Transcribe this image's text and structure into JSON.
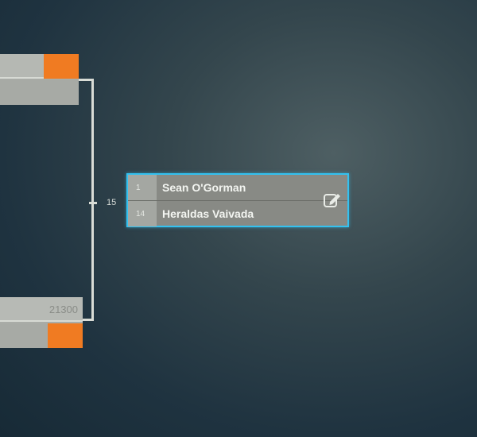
{
  "bracket": {
    "round_number": "15",
    "match": {
      "player1": {
        "seed": "1",
        "name": "Sean O'Gorman"
      },
      "player2": {
        "seed": "14",
        "name": "Heraldas Vaivada"
      }
    },
    "upper_feeder": {
      "score": ""
    },
    "lower_feeder": {
      "score": "21300"
    }
  },
  "icons": {
    "edit": "edit-icon"
  },
  "colors": {
    "highlight_border": "#33c1f0",
    "score_badge": "#f07b22"
  }
}
